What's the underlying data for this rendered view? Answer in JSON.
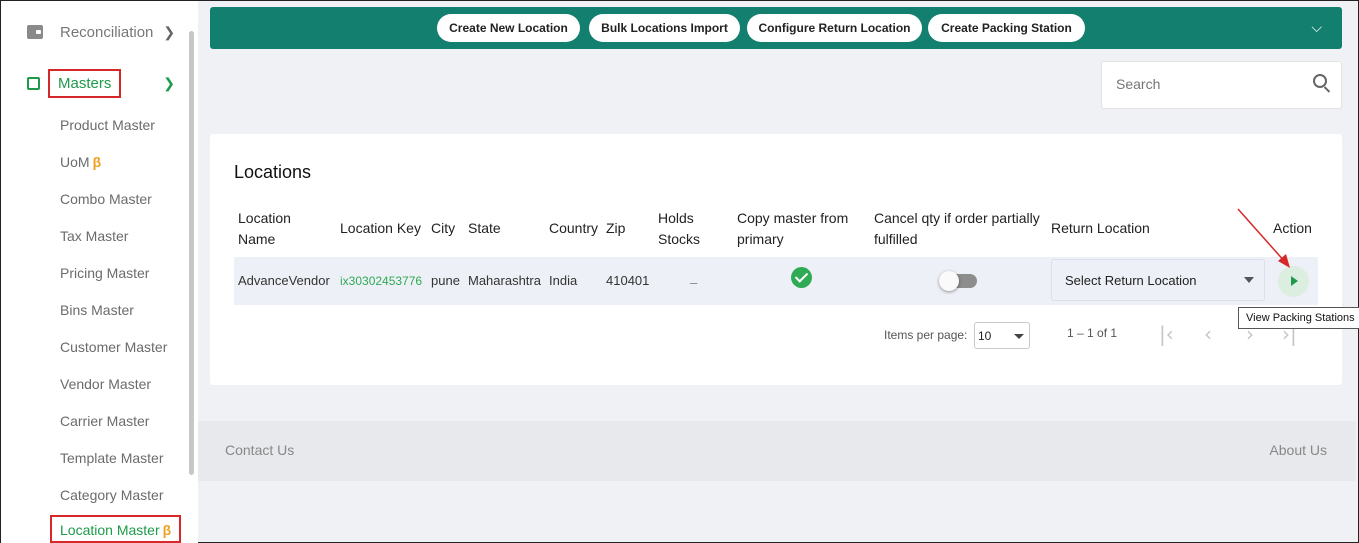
{
  "sidebar": {
    "reconciliation": "Reconciliation",
    "masters": "Masters",
    "beta_symbol": "β",
    "items": [
      {
        "label": "Product Master",
        "beta": false
      },
      {
        "label": "UoM",
        "beta": true
      },
      {
        "label": "Combo Master",
        "beta": false
      },
      {
        "label": "Tax Master",
        "beta": false
      },
      {
        "label": "Pricing Master",
        "beta": false
      },
      {
        "label": "Bins Master",
        "beta": false
      },
      {
        "label": "Customer Master",
        "beta": false
      },
      {
        "label": "Vendor Master",
        "beta": false
      },
      {
        "label": "Carrier Master",
        "beta": false
      },
      {
        "label": "Template Master",
        "beta": false
      },
      {
        "label": "Category Master",
        "beta": false
      }
    ],
    "active_item": "Location Master"
  },
  "toolbar": {
    "buttons": [
      "Create New Location",
      "Bulk Locations Import",
      "Configure Return Location",
      "Create Packing Station"
    ]
  },
  "search": {
    "placeholder": "Search"
  },
  "locations": {
    "title": "Locations",
    "headers": {
      "location_name": "Location Name",
      "location_key": "Location Key",
      "city": "City",
      "state": "State",
      "country": "Country",
      "zip": "Zip",
      "holds_stocks": "Holds Stocks",
      "copy_master": "Copy master from primary",
      "cancel_qty": "Cancel qty if order partially fulfilled",
      "return_location": "Return Location",
      "action": "Action"
    },
    "row": {
      "location_name": "AdvanceVendor",
      "location_key": "ix30302453776",
      "city": "pune",
      "state": "Maharashtra",
      "country": "India",
      "zip": "410401",
      "holds_stocks": "_",
      "return_location_placeholder": "Select Return Location"
    },
    "pagination": {
      "items_per_page_label": "Items per page:",
      "items_per_page_value": "10",
      "range": "1 – 1 of 1"
    },
    "tooltip": "View Packing Stations"
  },
  "footer": {
    "contact": "Contact Us",
    "about": "About Us"
  },
  "colors": {
    "teal": "#137f6f",
    "green": "#1e9a4a",
    "annotation_red": "#d62828"
  }
}
